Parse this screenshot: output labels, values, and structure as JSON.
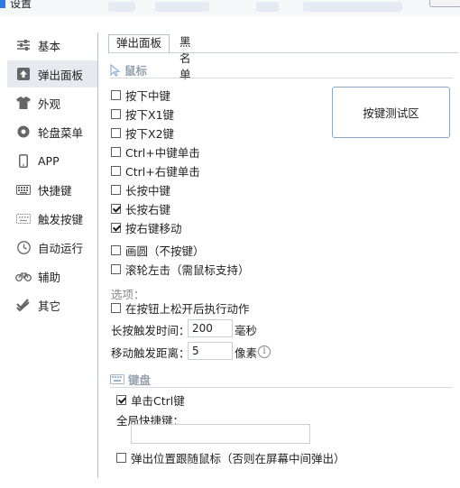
{
  "window": {
    "title": "设置"
  },
  "sidebar": {
    "items": [
      {
        "label": "基本",
        "icon": "sliders-icon"
      },
      {
        "label": "弹出面板",
        "icon": "upload-arrow-icon"
      },
      {
        "label": "外观",
        "icon": "tshirt-icon"
      },
      {
        "label": "轮盘菜单",
        "icon": "dial-icon"
      },
      {
        "label": "APP",
        "icon": "phone-icon"
      },
      {
        "label": "快捷键",
        "icon": "keyboard-icon"
      },
      {
        "label": "触发按键",
        "icon": "keyboard-dotted-icon"
      },
      {
        "label": "自动运行",
        "icon": "clock-icon"
      },
      {
        "label": "辅助",
        "icon": "bicycle-icon"
      },
      {
        "label": "其它",
        "icon": "double-check-icon"
      }
    ],
    "active_index": 1
  },
  "tabs": [
    {
      "label": "弹出面板",
      "active": true
    },
    {
      "label": "黑名单",
      "active": false
    }
  ],
  "mouse_section": {
    "title": "鼠标",
    "options": [
      {
        "label": "按下中键",
        "checked": false
      },
      {
        "label": "按下X1键",
        "checked": false
      },
      {
        "label": "按下X2键",
        "checked": false
      },
      {
        "label": "Ctrl+中键单击",
        "checked": false
      },
      {
        "label": "Ctrl+右键单击",
        "checked": false
      },
      {
        "label": "长按中键",
        "checked": false
      },
      {
        "label": "长按右键",
        "checked": true
      },
      {
        "label": "按右键移动",
        "checked": true
      },
      {
        "label": "画圆（不按键）",
        "checked": false
      },
      {
        "label": "滚轮左击（需鼠标支持）",
        "checked": false
      }
    ],
    "test_area_label": "按键测试区",
    "options_label": "选项：",
    "release_option": {
      "label": "在按钮上松开后执行动作",
      "checked": false
    },
    "long_press": {
      "label": "长按触发时间：",
      "value": "200",
      "unit": "毫秒"
    },
    "move_distance": {
      "label": "移动触发距离：",
      "value": "5",
      "unit": "像素"
    }
  },
  "keyboard_section": {
    "title": "键盘",
    "ctrl_option": {
      "label": "单击Ctrl键",
      "checked": true
    },
    "global_hotkey_label": "全局快捷键：",
    "global_hotkey_value": "",
    "follow_mouse_option": {
      "label": "弹出位置跟随鼠标（否则在屏幕中间弹出）",
      "checked": false
    }
  },
  "colors": {
    "accent": "#2e7be0",
    "active_nav": "#e6e9ee",
    "section_title": "#98a2b0",
    "test_border": "#8aa7c7"
  }
}
